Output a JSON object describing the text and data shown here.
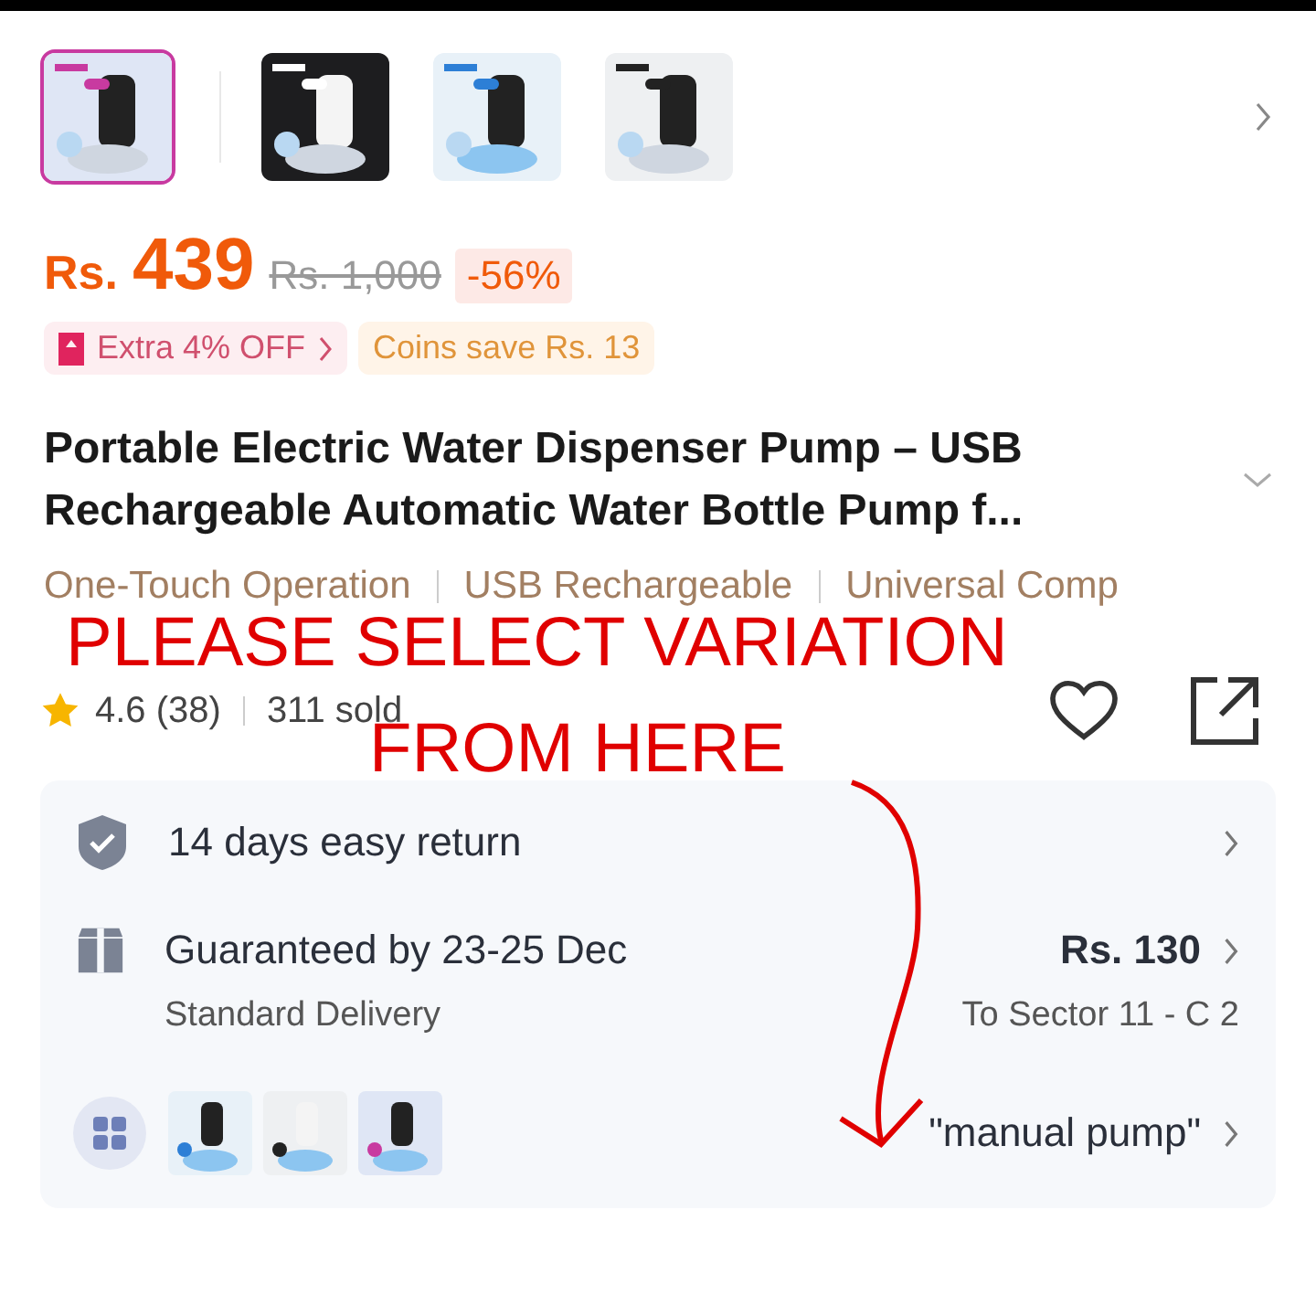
{
  "gallery": {
    "thumbnails": [
      {
        "kind": "picture",
        "selected": true
      },
      {
        "kind": "picture",
        "selected": false
      },
      {
        "kind": "picture",
        "selected": false
      },
      {
        "kind": "picture",
        "selected": false
      }
    ]
  },
  "price": {
    "currency": "Rs.",
    "amount": "439",
    "original": "Rs. 1,000",
    "discount": "-56%"
  },
  "promos": {
    "voucher": "Extra 4% OFF",
    "coins": "Coins save Rs. 13"
  },
  "title": "Portable Electric Water Dispenser Pump – USB Rechargeable Automatic Water Bottle Pump f...",
  "features": [
    "One-Touch Operation",
    "USB Rechargeable",
    "Universal Comp"
  ],
  "rating": {
    "score": "4.6 (38)",
    "sold": "311 sold"
  },
  "service": {
    "return": "14 days easy return",
    "delivery": {
      "title": "Guaranteed by 23-25 Dec",
      "subtitle": "Standard Delivery",
      "fee": "Rs. 130",
      "destination": "To Sector 11 - C 2"
    },
    "variation": {
      "thumbnails": [
        {
          "kind": "picture"
        },
        {
          "kind": "picture"
        },
        {
          "kind": "picture"
        }
      ],
      "value": "\"manual pump\""
    }
  },
  "annotation": {
    "lines": [
      "PLEASE SELECT VARIATION",
      "FROM HERE"
    ]
  }
}
